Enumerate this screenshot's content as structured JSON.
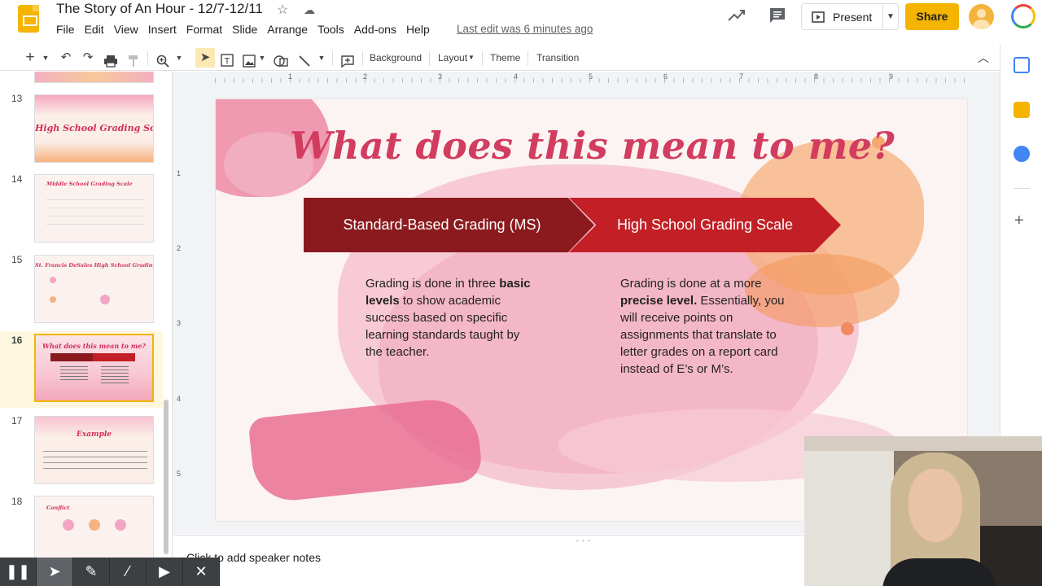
{
  "header": {
    "doc_title": "The Story of An Hour - 12/7-12/11",
    "last_edit": "Last edit was 6 minutes ago",
    "present_label": "Present",
    "share_label": "Share",
    "menu": [
      "File",
      "Edit",
      "View",
      "Insert",
      "Format",
      "Slide",
      "Arrange",
      "Tools",
      "Add-ons",
      "Help"
    ]
  },
  "toolbar": {
    "background": "Background",
    "layout": "Layout",
    "theme": "Theme",
    "transition": "Transition"
  },
  "ruler": {
    "h_marks": [
      "1",
      "2",
      "3",
      "4",
      "5",
      "6",
      "7",
      "8",
      "9"
    ],
    "v_marks": [
      "1",
      "2",
      "3",
      "4",
      "5"
    ]
  },
  "filmstrip": {
    "slides": [
      {
        "number": "13",
        "title": "High School Grading Scale"
      },
      {
        "number": "14",
        "title": "Middle School Grading Scale"
      },
      {
        "number": "15",
        "title": "St. Francis DeSales High School Grading Scale"
      },
      {
        "number": "16",
        "title": "What does this mean to me?"
      },
      {
        "number": "17",
        "title": "Example"
      },
      {
        "number": "18",
        "title": "Conflict"
      }
    ],
    "selected": "16"
  },
  "slide": {
    "title": "What does this mean to me?",
    "left_header": "Standard-Based Grading (MS)",
    "right_header": "High School Grading Scale",
    "left_body": {
      "p1": "Grading is done in three ",
      "b1": "basic levels",
      "p2": " to show academic success based on specific learning standards taught by the teacher."
    },
    "right_body": {
      "p1": "Grading is done at a more ",
      "b1": "precise level.",
      "p2": " Essentially, you will receive points on assignments that translate to letter grades on a report card instead of E’s or M’s."
    }
  },
  "notes": {
    "placeholder": "Click to add speaker notes"
  },
  "colors": {
    "accent_yellow": "#f4b400",
    "slide_title": "#d23c5f",
    "chevron_dark": "#8b1a1e",
    "chevron_red": "#c22026"
  }
}
